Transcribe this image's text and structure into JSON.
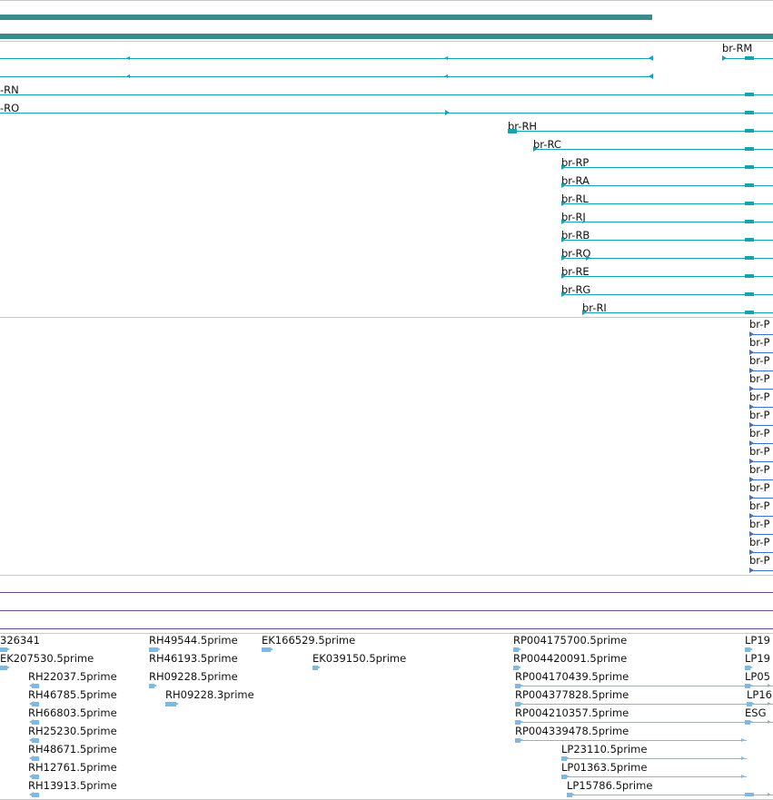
{
  "colors": {
    "gene": "#3a8c8c",
    "transcript": "#1aa0b4",
    "protein": "#3b6fd1",
    "est": "#7fb8e0",
    "est_line": "#7fb8e0",
    "purple": "#6a4c93",
    "separator": "#c8c8c8"
  },
  "tracks": {
    "transcripts": {
      "labels": [
        "br-RM",
        "-RN",
        "-RO",
        "br-RH",
        "br-RC",
        "br-RP",
        "br-RA",
        "br-RL",
        "br-RJ",
        "br-RB",
        "br-RQ",
        "br-RE",
        "br-RG",
        "br-RI"
      ]
    },
    "proteins": {
      "labels": [
        "br-P",
        "br-P",
        "br-P",
        "br-P",
        "br-P",
        "br-P",
        "br-P",
        "br-P",
        "br-P",
        "br-P",
        "br-P",
        "br-P",
        "br-P",
        "br-P"
      ]
    },
    "ests": {
      "labels": [
        "326341",
        "RH49544.5prime",
        "EK166529.5prime",
        "RP004175700.5prime",
        "LP19",
        "EK207530.5prime",
        "RH46193.5prime",
        "EK039150.5prime",
        "RP004420091.5prime",
        "LP19",
        "RH22037.5prime",
        "RH09228.5prime",
        "RP004170439.5prime",
        "LP05",
        "RH46785.5prime",
        "RH09228.3prime",
        "RP004377828.5prime",
        "LP16",
        "RH66803.5prime",
        "RP004210357.5prime",
        "ESG",
        "RH25230.5prime",
        "RP004339478.5prime",
        "RH48671.5prime",
        "LP23110.5prime",
        "RH12761.5prime",
        "LP01363.5prime",
        "RH13913.5prime",
        "LP15786.5prime"
      ]
    }
  }
}
